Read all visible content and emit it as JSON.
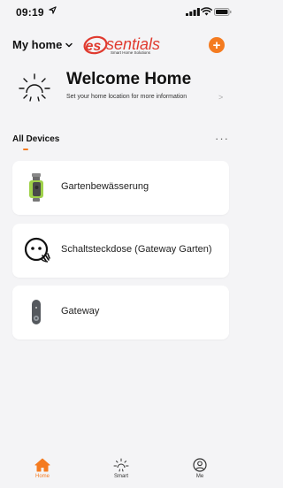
{
  "status_bar": {
    "time": "09:19"
  },
  "header": {
    "home_label": "My home",
    "logo_text": "essentials",
    "logo_subtitle": "Smart Home Solutions",
    "add_symbol": "+"
  },
  "welcome": {
    "title": "Welcome Home",
    "subtitle": "Set your home location for more information",
    "arrow": ">"
  },
  "devices": {
    "section_title": "All Devices",
    "more_symbol": "···",
    "items": [
      {
        "name": "Gartenbewässerung",
        "icon": "water-timer-icon"
      },
      {
        "name": "Schaltsteckdose (Gateway Garten)",
        "icon": "smart-plug-icon"
      },
      {
        "name": "Gateway",
        "icon": "gateway-icon"
      }
    ]
  },
  "tabs": [
    {
      "label": "Home",
      "icon": "home-icon",
      "active": true
    },
    {
      "label": "Smart",
      "icon": "sun-icon",
      "active": false
    },
    {
      "label": "Me",
      "icon": "profile-icon",
      "active": false
    }
  ],
  "colors": {
    "accent": "#f47b20",
    "background": "#f4f4f6",
    "card": "#ffffff"
  }
}
